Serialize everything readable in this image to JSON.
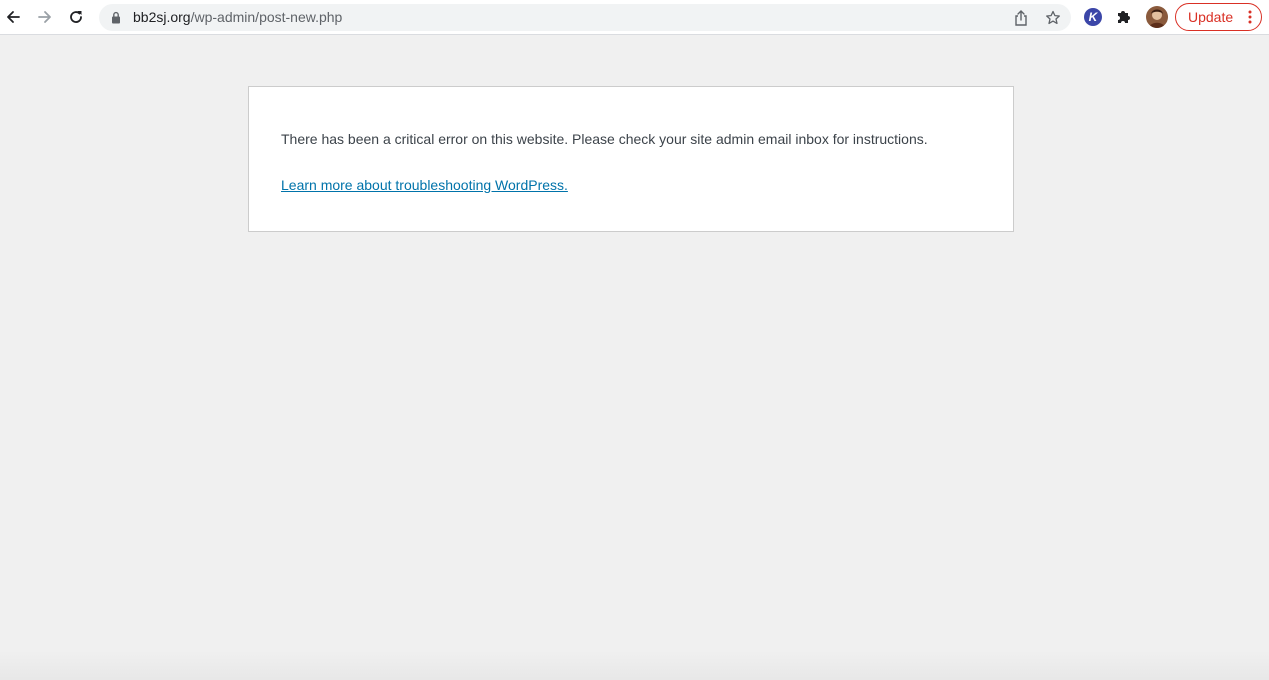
{
  "browser": {
    "back_icon": "arrow-left-icon",
    "forward_icon": "arrow-right-icon",
    "reload_icon": "reload-icon",
    "address_bar": {
      "lock_icon": "lock-icon",
      "url_host": "bb2sj.org",
      "url_path": "/wp-admin/post-new.php",
      "share_icon": "share-icon",
      "bookmark_icon": "star-icon"
    },
    "extensions": {
      "k_extension_label": "K",
      "puzzle_icon": "puzzle-icon"
    },
    "profile_icon": "avatar",
    "update_button": {
      "label": "Update",
      "menu_icon": "kebab-menu-icon"
    },
    "colors": {
      "update_red": "#d93025",
      "omnibox_bg": "#f1f3f4"
    }
  },
  "page": {
    "background": "#f0f0f0",
    "error": {
      "message": "There has been a critical error on this website. Please check your site admin email inbox for instructions.",
      "link_text": "Learn more about troubleshooting WordPress.",
      "link_color": "#0073aa"
    }
  }
}
